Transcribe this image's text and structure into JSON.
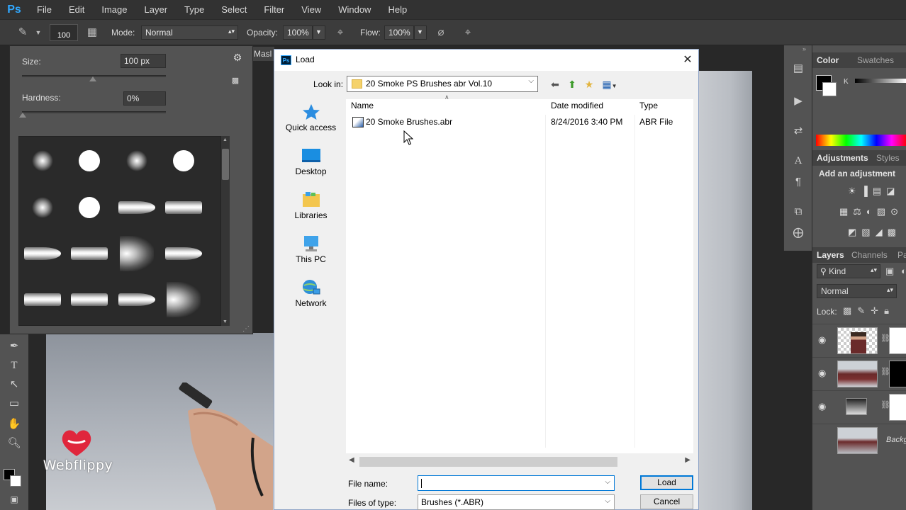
{
  "app": {
    "logo": "Ps"
  },
  "menu": [
    "File",
    "Edit",
    "Image",
    "Layer",
    "Type",
    "Select",
    "Filter",
    "View",
    "Window",
    "Help"
  ],
  "options": {
    "brush_size": "100",
    "mode_label": "Mode:",
    "mode_value": "Normal",
    "opacity_label": "Opacity:",
    "opacity_value": "100%",
    "flow_label": "Flow:",
    "flow_value": "100%"
  },
  "brush_picker": {
    "size_label": "Size:",
    "size_value": "100 px",
    "hardness_label": "Hardness:",
    "hardness_value": "0%"
  },
  "document": {
    "tab_label": "Masl",
    "watermark": "Webflippy"
  },
  "dialog": {
    "title": "Load",
    "look_in_label": "Look in:",
    "look_in_value": "20 Smoke PS Brushes abr Vol.10",
    "places": [
      "Quick access",
      "Desktop",
      "Libraries",
      "This PC",
      "Network"
    ],
    "columns": {
      "name": "Name",
      "date": "Date modified",
      "type": "Type"
    },
    "files": [
      {
        "name": "20 Smoke Brushes.abr",
        "date": "8/24/2016 3:40 PM",
        "type": "ABR File"
      }
    ],
    "file_name_label": "File name:",
    "file_name_value": "",
    "files_of_type_label": "Files of type:",
    "files_of_type_value": "Brushes (*.ABR)",
    "load_button": "Load",
    "cancel_button": "Cancel"
  },
  "right_panels": {
    "color_tabs": [
      "Color",
      "Swatches"
    ],
    "k_label": "K",
    "adjustment_tabs": [
      "Adjustments",
      "Styles"
    ],
    "add_adjustment": "Add an adjustment",
    "layers_tabs": [
      "Layers",
      "Channels",
      "Pa"
    ],
    "kind_value": "Kind",
    "blend_value": "Normal",
    "lock_label": "Lock:",
    "layers": [
      {
        "name": ""
      },
      {
        "name": ""
      },
      {
        "name": ""
      },
      {
        "name": "Backg"
      }
    ]
  },
  "colors": {
    "accent": "#0078d7",
    "ps_blue": "#31a8ff",
    "panel": "#535353",
    "dialog_bg": "#f0f0f0"
  }
}
